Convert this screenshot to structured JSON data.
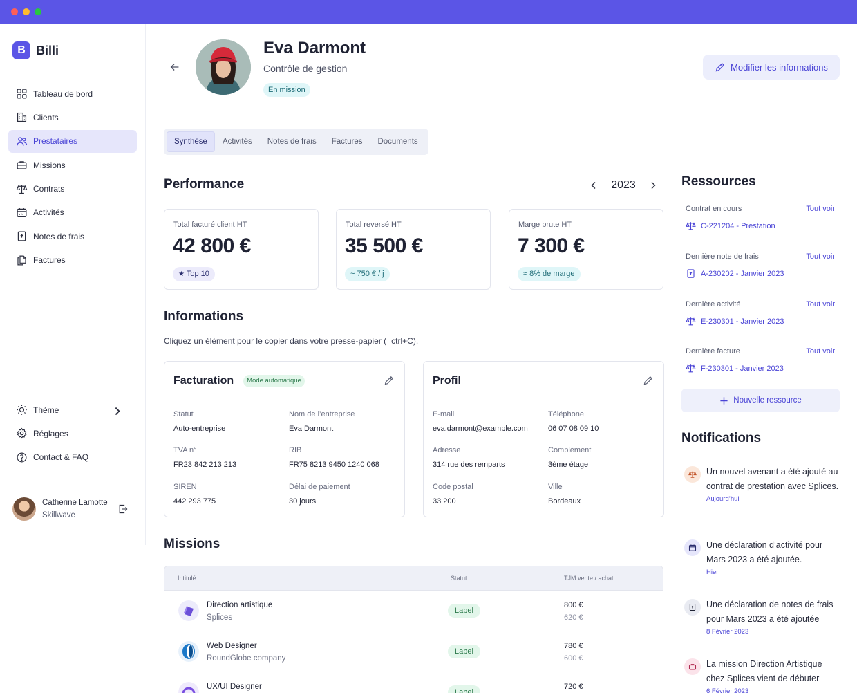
{
  "app": {
    "name": "Billi",
    "logo_letter": "B",
    "accent": "#5b55e6"
  },
  "sidebar": {
    "items": [
      {
        "label": "Tableau de bord",
        "icon": "grid-icon"
      },
      {
        "label": "Clients",
        "icon": "building-icon"
      },
      {
        "label": "Prestataires",
        "icon": "users-icon",
        "active": true
      },
      {
        "label": "Missions",
        "icon": "briefcase-icon"
      },
      {
        "label": "Contrats",
        "icon": "scale-icon"
      },
      {
        "label": "Activités",
        "icon": "calendar-icon"
      },
      {
        "label": "Notes de frais",
        "icon": "receipt-icon"
      },
      {
        "label": "Factures",
        "icon": "documents-icon"
      }
    ],
    "bottom": [
      {
        "label": "Thème",
        "icon": "sun-icon"
      },
      {
        "label": "Réglages",
        "icon": "gear-icon"
      },
      {
        "label": "Contact & FAQ",
        "icon": "help-icon"
      }
    ],
    "user": {
      "name": "Catherine Lamotte",
      "company": "Skillwave"
    }
  },
  "profile": {
    "name": "Eva Darmont",
    "role": "Contrôle de gestion",
    "status": "En mission",
    "edit_label": "Modifier les informations"
  },
  "tabs": [
    "Synthèse",
    "Activités",
    "Notes de frais",
    "Factures",
    "Documents"
  ],
  "performance": {
    "title": "Performance",
    "year": "2023",
    "kpis": [
      {
        "label": "Total facturé client HT",
        "value": "42 800 €",
        "badge": "Top 10",
        "badge_icon": "star-icon"
      },
      {
        "label": "Total reversé HT",
        "value": "35 500 €",
        "badge": "~ 750 € / j"
      },
      {
        "label": "Marge brute HT",
        "value": "7 300 €",
        "badge": "≈ 8% de marge"
      }
    ]
  },
  "informations": {
    "title": "Informations",
    "hint": "Cliquez un élément pour le copier dans votre presse-papier (=ctrl+C).",
    "facturation": {
      "title": "Facturation",
      "badge": "Mode automatique",
      "fields": [
        {
          "label": "Statut",
          "value": "Auto-entreprise"
        },
        {
          "label": "Nom de l’entreprise",
          "value": "Eva Darmont"
        },
        {
          "label": "TVA n°",
          "value": "FR23 842 213 213"
        },
        {
          "label": "RIB",
          "value": "FR75 8213 9450 1240 068"
        },
        {
          "label": "SIREN",
          "value": "442 293 775"
        },
        {
          "label": "Délai de paiement",
          "value": "30 jours"
        }
      ]
    },
    "profil": {
      "title": "Profil",
      "fields": [
        {
          "label": "E-mail",
          "value": "eva.darmont@example.com"
        },
        {
          "label": "Téléphone",
          "value": "06 07 08 09 10"
        },
        {
          "label": "Adresse",
          "value": "314 rue des remparts"
        },
        {
          "label": "Complément",
          "value": "3ème étage"
        },
        {
          "label": "Code postal",
          "value": "33 200"
        },
        {
          "label": "Ville",
          "value": "Bordeaux"
        }
      ]
    }
  },
  "missions": {
    "title": "Missions",
    "columns": [
      "Intitulé",
      "Statut",
      "TJM vente / achat"
    ],
    "rows": [
      {
        "title": "Direction artistique",
        "client": "Splices",
        "status": "Label",
        "sell": "800 €",
        "buy": "620 €"
      },
      {
        "title": "Web Designer",
        "client": "RoundGlobe company",
        "status": "Label",
        "sell": "780 €",
        "buy": "600 €"
      },
      {
        "title": "UX/UI Designer",
        "client": "",
        "status": "Label",
        "sell": "720 €",
        "buy": ""
      }
    ]
  },
  "ressources": {
    "title": "Ressources",
    "items": [
      {
        "label": "Contrat en cours",
        "link": "C-221204 - Prestation",
        "all": "Tout voir",
        "icon": "scale-icon"
      },
      {
        "label": "Dernière note de frais",
        "link": "A-230202 - Janvier 2023",
        "all": "Tout voir",
        "icon": "receipt-icon"
      },
      {
        "label": "Dernière activité",
        "link": "E-230301 - Janvier 2023",
        "all": "Tout voir",
        "icon": "scale-icon"
      },
      {
        "label": "Dernière facture",
        "link": "F-230301 - Janvier 2023",
        "all": "Tout voir",
        "icon": "scale-icon"
      }
    ],
    "new_label": "Nouvelle ressource"
  },
  "notifications": {
    "title": "Notifications",
    "items": [
      {
        "text": "Un nouvel avenant a été ajouté au contrat de prestation avec Splices.",
        "date": "Aujourd’hui",
        "icon": "scale-icon"
      },
      {
        "text": "Une déclaration d’activité pour Mars 2023 a été ajoutée.",
        "date": "Hier",
        "icon": "calendar-icon"
      },
      {
        "text": "Une déclaration de notes de frais pour Mars 2023 a été ajoutée",
        "date": "8 Février 2023",
        "icon": "receipt-icon"
      },
      {
        "text": "La mission Direction Artistique chez Splices vient de débuter",
        "date": "6 Février 2023",
        "icon": "briefcase-icon"
      }
    ]
  }
}
